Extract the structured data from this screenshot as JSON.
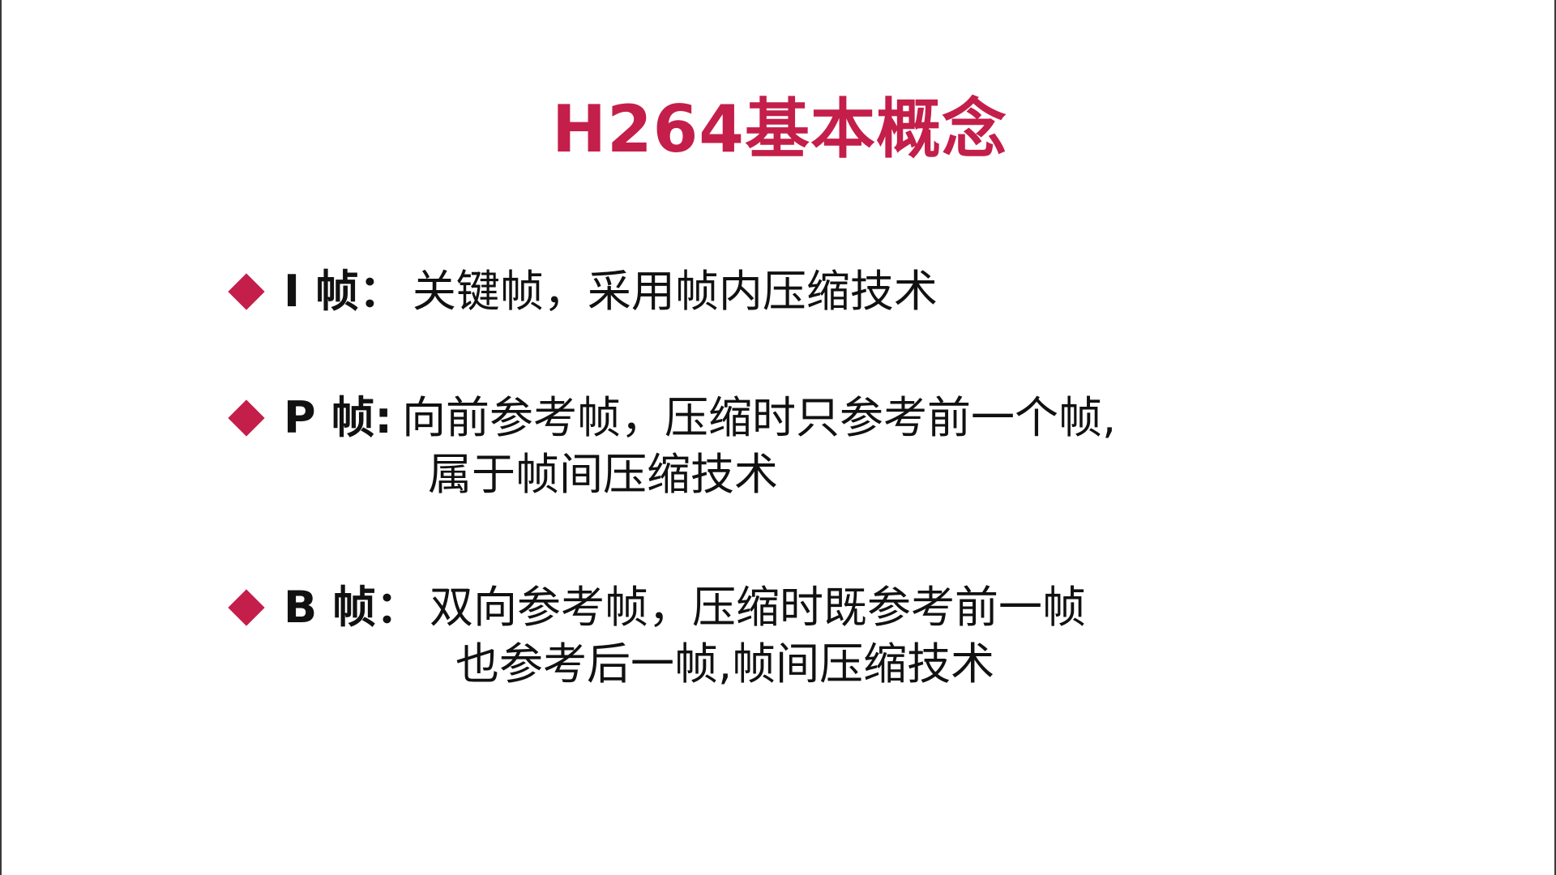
{
  "title": "H264基本概念",
  "accent_color": "#c41e4a",
  "bullet_icon": "diamond-icon",
  "items": [
    {
      "label": "I 帧：",
      "lines": [
        "关键帧，采用帧内压缩技术"
      ]
    },
    {
      "label": "P 帧:",
      "lines": [
        "向前参考帧，压缩时只参考前一个帧,",
        "属于帧间压缩技术"
      ]
    },
    {
      "label": "B 帧：",
      "lines": [
        "双向参考帧，压缩时既参考前一帧",
        "也参考后一帧,帧间压缩技术"
      ]
    }
  ]
}
